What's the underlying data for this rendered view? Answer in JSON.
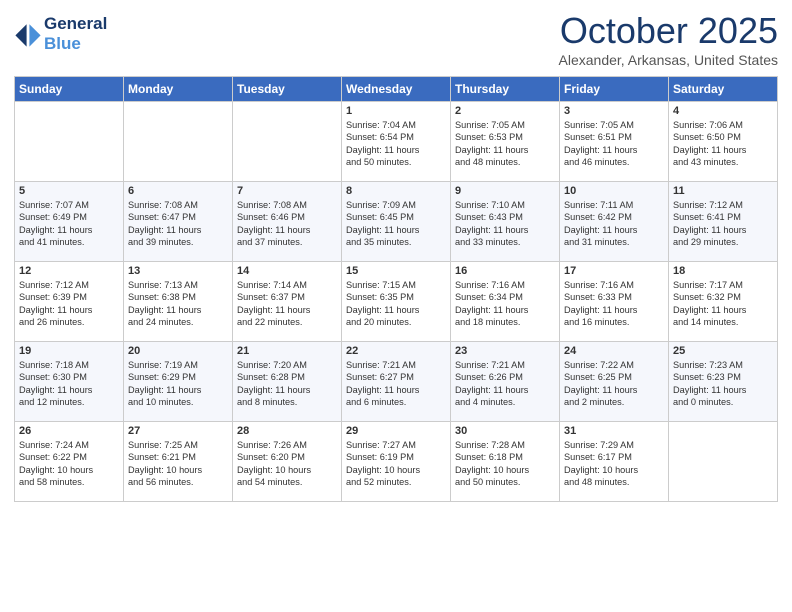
{
  "header": {
    "logo_line1": "General",
    "logo_line2": "Blue",
    "month": "October 2025",
    "location": "Alexander, Arkansas, United States"
  },
  "weekdays": [
    "Sunday",
    "Monday",
    "Tuesday",
    "Wednesday",
    "Thursday",
    "Friday",
    "Saturday"
  ],
  "weeks": [
    [
      {
        "day": "",
        "info": ""
      },
      {
        "day": "",
        "info": ""
      },
      {
        "day": "",
        "info": ""
      },
      {
        "day": "1",
        "info": "Sunrise: 7:04 AM\nSunset: 6:54 PM\nDaylight: 11 hours\nand 50 minutes."
      },
      {
        "day": "2",
        "info": "Sunrise: 7:05 AM\nSunset: 6:53 PM\nDaylight: 11 hours\nand 48 minutes."
      },
      {
        "day": "3",
        "info": "Sunrise: 7:05 AM\nSunset: 6:51 PM\nDaylight: 11 hours\nand 46 minutes."
      },
      {
        "day": "4",
        "info": "Sunrise: 7:06 AM\nSunset: 6:50 PM\nDaylight: 11 hours\nand 43 minutes."
      }
    ],
    [
      {
        "day": "5",
        "info": "Sunrise: 7:07 AM\nSunset: 6:49 PM\nDaylight: 11 hours\nand 41 minutes."
      },
      {
        "day": "6",
        "info": "Sunrise: 7:08 AM\nSunset: 6:47 PM\nDaylight: 11 hours\nand 39 minutes."
      },
      {
        "day": "7",
        "info": "Sunrise: 7:08 AM\nSunset: 6:46 PM\nDaylight: 11 hours\nand 37 minutes."
      },
      {
        "day": "8",
        "info": "Sunrise: 7:09 AM\nSunset: 6:45 PM\nDaylight: 11 hours\nand 35 minutes."
      },
      {
        "day": "9",
        "info": "Sunrise: 7:10 AM\nSunset: 6:43 PM\nDaylight: 11 hours\nand 33 minutes."
      },
      {
        "day": "10",
        "info": "Sunrise: 7:11 AM\nSunset: 6:42 PM\nDaylight: 11 hours\nand 31 minutes."
      },
      {
        "day": "11",
        "info": "Sunrise: 7:12 AM\nSunset: 6:41 PM\nDaylight: 11 hours\nand 29 minutes."
      }
    ],
    [
      {
        "day": "12",
        "info": "Sunrise: 7:12 AM\nSunset: 6:39 PM\nDaylight: 11 hours\nand 26 minutes."
      },
      {
        "day": "13",
        "info": "Sunrise: 7:13 AM\nSunset: 6:38 PM\nDaylight: 11 hours\nand 24 minutes."
      },
      {
        "day": "14",
        "info": "Sunrise: 7:14 AM\nSunset: 6:37 PM\nDaylight: 11 hours\nand 22 minutes."
      },
      {
        "day": "15",
        "info": "Sunrise: 7:15 AM\nSunset: 6:35 PM\nDaylight: 11 hours\nand 20 minutes."
      },
      {
        "day": "16",
        "info": "Sunrise: 7:16 AM\nSunset: 6:34 PM\nDaylight: 11 hours\nand 18 minutes."
      },
      {
        "day": "17",
        "info": "Sunrise: 7:16 AM\nSunset: 6:33 PM\nDaylight: 11 hours\nand 16 minutes."
      },
      {
        "day": "18",
        "info": "Sunrise: 7:17 AM\nSunset: 6:32 PM\nDaylight: 11 hours\nand 14 minutes."
      }
    ],
    [
      {
        "day": "19",
        "info": "Sunrise: 7:18 AM\nSunset: 6:30 PM\nDaylight: 11 hours\nand 12 minutes."
      },
      {
        "day": "20",
        "info": "Sunrise: 7:19 AM\nSunset: 6:29 PM\nDaylight: 11 hours\nand 10 minutes."
      },
      {
        "day": "21",
        "info": "Sunrise: 7:20 AM\nSunset: 6:28 PM\nDaylight: 11 hours\nand 8 minutes."
      },
      {
        "day": "22",
        "info": "Sunrise: 7:21 AM\nSunset: 6:27 PM\nDaylight: 11 hours\nand 6 minutes."
      },
      {
        "day": "23",
        "info": "Sunrise: 7:21 AM\nSunset: 6:26 PM\nDaylight: 11 hours\nand 4 minutes."
      },
      {
        "day": "24",
        "info": "Sunrise: 7:22 AM\nSunset: 6:25 PM\nDaylight: 11 hours\nand 2 minutes."
      },
      {
        "day": "25",
        "info": "Sunrise: 7:23 AM\nSunset: 6:23 PM\nDaylight: 11 hours\nand 0 minutes."
      }
    ],
    [
      {
        "day": "26",
        "info": "Sunrise: 7:24 AM\nSunset: 6:22 PM\nDaylight: 10 hours\nand 58 minutes."
      },
      {
        "day": "27",
        "info": "Sunrise: 7:25 AM\nSunset: 6:21 PM\nDaylight: 10 hours\nand 56 minutes."
      },
      {
        "day": "28",
        "info": "Sunrise: 7:26 AM\nSunset: 6:20 PM\nDaylight: 10 hours\nand 54 minutes."
      },
      {
        "day": "29",
        "info": "Sunrise: 7:27 AM\nSunset: 6:19 PM\nDaylight: 10 hours\nand 52 minutes."
      },
      {
        "day": "30",
        "info": "Sunrise: 7:28 AM\nSunset: 6:18 PM\nDaylight: 10 hours\nand 50 minutes."
      },
      {
        "day": "31",
        "info": "Sunrise: 7:29 AM\nSunset: 6:17 PM\nDaylight: 10 hours\nand 48 minutes."
      },
      {
        "day": "",
        "info": ""
      }
    ]
  ]
}
